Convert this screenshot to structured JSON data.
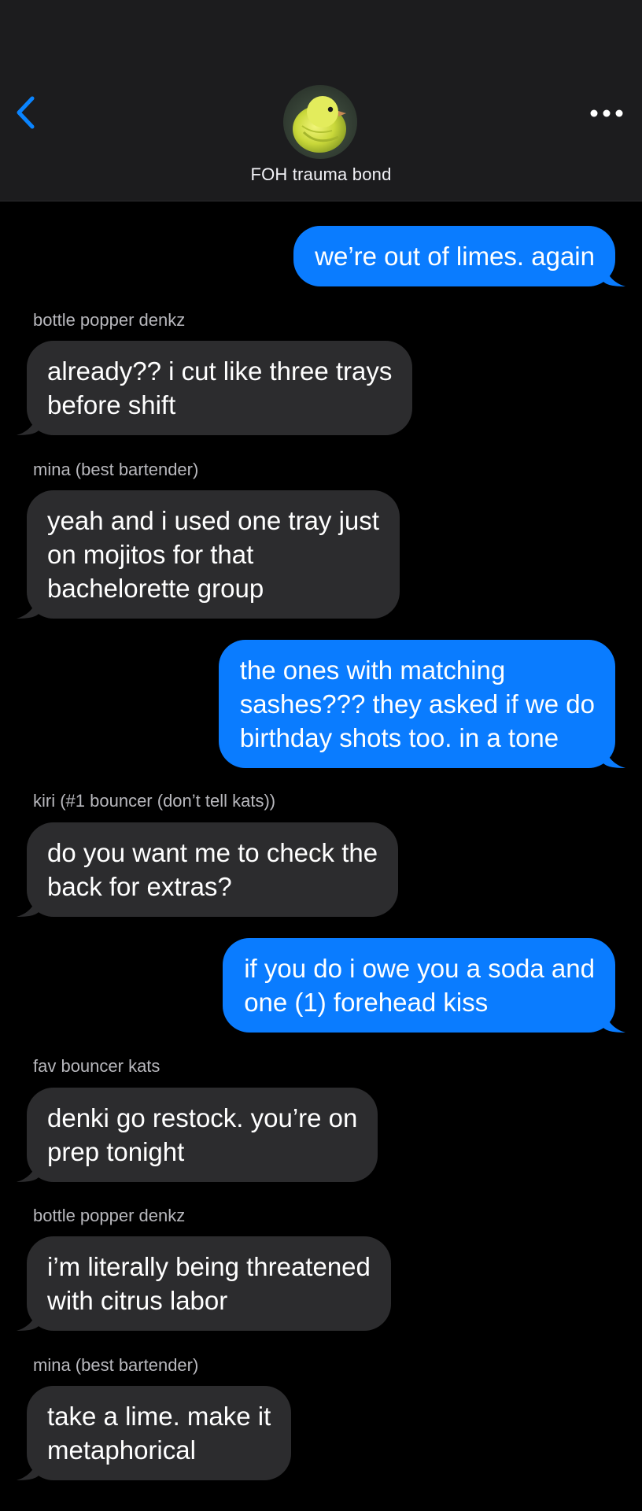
{
  "header": {
    "group_name": "FOH trauma bond",
    "back_icon": "chevron-left-icon",
    "more_icon": "ellipsis-icon",
    "avatar_icon": "bird-avatar-icon",
    "back_color": "#0a84ff"
  },
  "colors": {
    "outgoing_bubble": "#0a7cff",
    "incoming_bubble": "#2c2c2e",
    "background": "#000000",
    "header_background": "#1c1c1e"
  },
  "messages": [
    {
      "direction": "out",
      "lines": [
        "we’re out of limes. again"
      ]
    },
    {
      "direction": "in",
      "sender": "bottle popper denkz",
      "lines": [
        "already?? i cut like three trays",
        "before shift"
      ]
    },
    {
      "direction": "in",
      "sender": "mina (best bartender)",
      "lines": [
        "yeah and i used one tray just",
        "on mojitos for that",
        "bachelorette group"
      ]
    },
    {
      "direction": "out",
      "lines": [
        "the ones with matching",
        "sashes??? they asked if we do",
        "birthday shots too. in a tone"
      ]
    },
    {
      "direction": "in",
      "sender": "kiri (#1 bouncer (don’t tell kats))",
      "lines": [
        "do you want me to check the",
        "back for extras?"
      ]
    },
    {
      "direction": "out",
      "lines": [
        "if you do i owe you a soda and",
        "one (1) forehead kiss"
      ]
    },
    {
      "direction": "in",
      "sender": "fav bouncer kats",
      "lines": [
        "denki go restock. you’re on",
        "prep tonight"
      ]
    },
    {
      "direction": "in",
      "sender": "bottle popper denkz",
      "lines": [
        "i’m literally being threatened",
        "with citrus labor"
      ]
    },
    {
      "direction": "in",
      "sender": "mina (best bartender)",
      "lines": [
        "take a lime. make it",
        "metaphorical"
      ]
    }
  ]
}
